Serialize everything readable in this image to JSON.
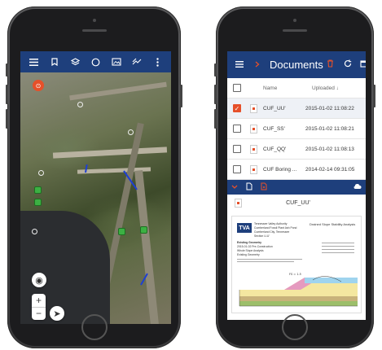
{
  "map_app": {
    "toolbar": {
      "icons": [
        "menu-icon",
        "bookmark-icon",
        "layers-icon",
        "circle-icon",
        "image-icon",
        "measure-icon",
        "more-icon"
      ]
    },
    "pin_label": "⊙",
    "zoom": {
      "in": "+",
      "out": "−"
    },
    "location_label": "◉",
    "compass_label": "➤"
  },
  "docs_app": {
    "title": "Documents",
    "columns": {
      "name": "Name",
      "uploaded": "Uploaded"
    },
    "rows": [
      {
        "name": "CUF_UU'",
        "date": "2015-01-02 11:08:22",
        "checked": true
      },
      {
        "name": "CUF_SS'",
        "date": "2015-01-02 11:08:21",
        "checked": false
      },
      {
        "name": "CUF_QQ'",
        "date": "2015-01-02 11:08:13",
        "checked": false
      },
      {
        "name": "CUF Boring ...",
        "date": "2014-02-14 09:31:05",
        "checked": false
      }
    ],
    "preview": {
      "file_name": "CUF_UU'",
      "logo_text": "TVA",
      "org_text": "Tennessee Valley Authority",
      "plant_text": "Cumberland Fossil Plant Ash Pond",
      "location_text": "Cumberland City, Tennessee",
      "section_text": "Section U-U'",
      "heading": "Drained Slope Stability Analysis",
      "existing_text": "Existing Geometry",
      "date_text": "2015-01-02 Pre-Construction",
      "analysis_text": "Whole Slope Analysis",
      "scenario_text": "Existing Geometry",
      "fs_text": "FS = 1.5"
    }
  }
}
